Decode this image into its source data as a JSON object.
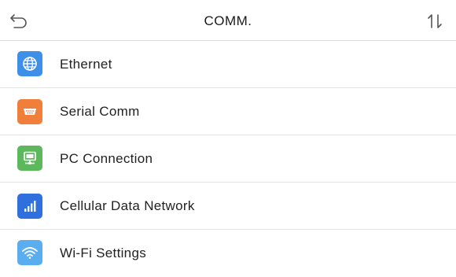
{
  "header": {
    "title": "COMM.",
    "back_icon": "back-arrow-icon",
    "sort_icon": "sort-arrows-icon"
  },
  "menu": {
    "items": [
      {
        "label": "Ethernet",
        "icon": "globe-icon",
        "color": "#3d8fe8"
      },
      {
        "label": "Serial Comm",
        "icon": "serial-port-icon",
        "color": "#f07f3c"
      },
      {
        "label": "PC Connection",
        "icon": "monitor-icon",
        "color": "#5cb85c"
      },
      {
        "label": "Cellular Data Network",
        "icon": "signal-bars-icon",
        "color": "#2f6fde"
      },
      {
        "label": "Wi-Fi Settings",
        "icon": "wifi-icon",
        "color": "#5aaef0"
      }
    ]
  }
}
